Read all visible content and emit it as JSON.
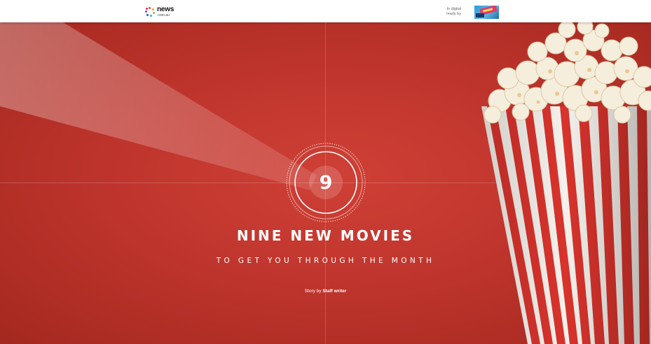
{
  "header": {
    "logo_word": "news",
    "logo_sub": ".com.au",
    "sponsor_line1": "In digital",
    "sponsor_line2": "ready by"
  },
  "hero": {
    "counter": "9",
    "title": "NINE NEW MOVIES",
    "subtitle": "TO GET YOU THROUGH THE MONTH",
    "byline_prefix": "Story by",
    "byline_author": "Staff writer"
  },
  "colors": {
    "hero_red": "#bf352d",
    "accent_white": "#ffffff"
  },
  "icons": {
    "logo": "news-logo-dots-icon",
    "sponsor": "sponsor-logo-icon",
    "popcorn": "popcorn-box-image"
  }
}
